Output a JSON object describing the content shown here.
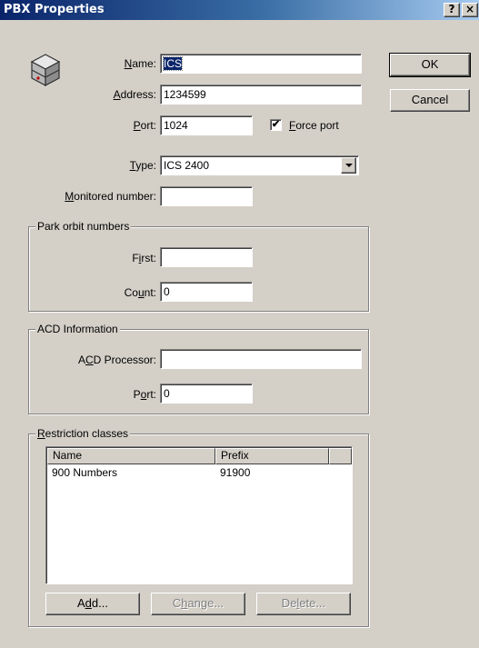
{
  "window": {
    "title": "PBX Properties",
    "help_label": "?",
    "close_label": "×"
  },
  "buttons": {
    "ok": "OK",
    "cancel": "Cancel",
    "add": "Add...",
    "change": "Change...",
    "delete": "Delete..."
  },
  "fields": {
    "name": {
      "label": "Name:",
      "value": "ICS"
    },
    "address": {
      "label": "Address:",
      "value": "1234599"
    },
    "port": {
      "label": "Port:",
      "value": "1024"
    },
    "force_port": {
      "label": "Force port",
      "checked": true,
      "mark": "✔"
    },
    "type": {
      "label": "Type:",
      "value": "ICS 2400"
    },
    "monitored_number": {
      "label": "Monitored number:",
      "value": ""
    }
  },
  "park_orbit": {
    "legend": "Park orbit numbers",
    "first_label": "First:",
    "first_value": "",
    "count_label": "Count:",
    "count_value": "0"
  },
  "acd": {
    "legend": "ACD Information",
    "processor_label": "ACD Processor:",
    "processor_value": "",
    "port_label": "Port:",
    "port_value": "0"
  },
  "restriction": {
    "legend": "Restriction classes",
    "columns": [
      "Name",
      "Prefix"
    ],
    "rows": [
      {
        "name": "900 Numbers",
        "prefix": "91900"
      }
    ]
  },
  "icons": {
    "pbx": "server-box-icon"
  }
}
